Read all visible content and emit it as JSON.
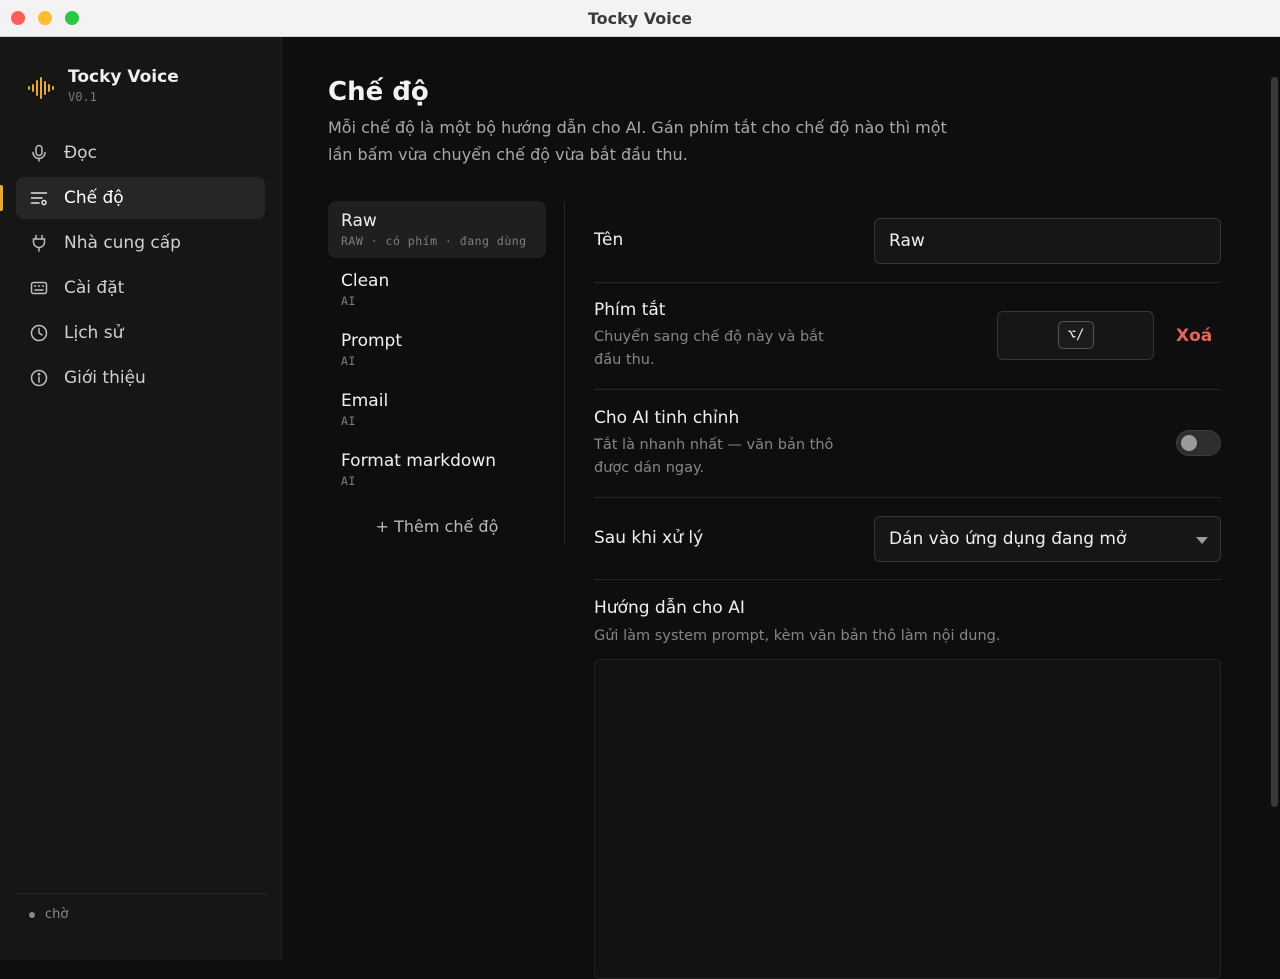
{
  "window": {
    "title": "Tocky Voice"
  },
  "brand": {
    "name": "Tocky Voice",
    "version": "V0.1"
  },
  "sidebar": {
    "items": [
      {
        "label": "Đọc",
        "icon": "microphone-icon"
      },
      {
        "label": "Chế độ",
        "icon": "modes-icon",
        "active": true
      },
      {
        "label": "Nhà cung cấp",
        "icon": "plug-icon"
      },
      {
        "label": "Cài đặt",
        "icon": "keyboard-icon"
      },
      {
        "label": "Lịch sử",
        "icon": "clock-icon"
      },
      {
        "label": "Giới thiệu",
        "icon": "info-icon"
      }
    ],
    "status": "chờ"
  },
  "page": {
    "title": "Chế độ",
    "description": "Mỗi chế độ là một bộ hướng dẫn cho AI. Gán phím tắt cho chế độ nào thì một lần bấm vừa chuyển chế độ vừa bắt đầu thu."
  },
  "modes": {
    "items": [
      {
        "name": "Raw",
        "meta": "RAW · có phím · đang dùng",
        "active": true
      },
      {
        "name": "Clean",
        "meta": "AI"
      },
      {
        "name": "Prompt",
        "meta": "AI"
      },
      {
        "name": "Email",
        "meta": "AI"
      },
      {
        "name": "Format markdown",
        "meta": "AI"
      }
    ],
    "add_label": "+ Thêm chế độ"
  },
  "detail": {
    "name_label": "Tên",
    "name_value": "Raw",
    "shortcut_label": "Phím tắt",
    "shortcut_sub": "Chuyển sang chế độ này và bắt đầu thu.",
    "shortcut_key": "⌥/",
    "delete_label": "Xoá",
    "ai_label": "Cho AI tinh chỉnh",
    "ai_sub": "Tắt là nhanh nhất — văn bản thô được dán ngay.",
    "ai_enabled": false,
    "after_label": "Sau khi xử lý",
    "after_value": "Dán vào ứng dụng đang mở",
    "prompt_label": "Hướng dẫn cho AI",
    "prompt_sub": "Gửi làm system prompt, kèm văn bản thô làm nội dung.",
    "prompt_value": ""
  },
  "colors": {
    "accent": "#e8a838",
    "danger": "#e5675a",
    "background": "#0e0e0e",
    "sidebar": "#161616"
  }
}
